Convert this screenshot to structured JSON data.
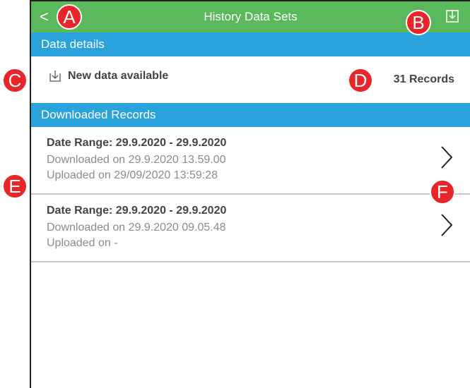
{
  "topbar": {
    "back_glyph": "<",
    "title": "History Data Sets"
  },
  "sections": {
    "data_details": "Data details",
    "downloaded_records": "Downloaded Records"
  },
  "details": {
    "new_data_label": "New data available",
    "records_count": "31 Records"
  },
  "records": [
    {
      "date_range": "Date Range: 29.9.2020 - 29.9.2020",
      "downloaded": "Downloaded on 29.9.2020 13.59.00",
      "uploaded": "Uploaded on 29/09/2020 13:59:28"
    },
    {
      "date_range": "Date Range: 29.9.2020 - 29.9.2020",
      "downloaded": "Downloaded on 29.9.2020 09.05.48",
      "uploaded": "Uploaded on -"
    }
  ],
  "markers": {
    "a": "A",
    "b": "B",
    "c": "C",
    "d": "D",
    "e": "E",
    "f": "F"
  },
  "colors": {
    "topbar": "#5cb85c",
    "section_header": "#2aa3dc",
    "marker": "#e8262a"
  },
  "icons": {
    "back": "chevron-left-icon",
    "download": "download-icon",
    "row_chevron": "chevron-right-icon"
  }
}
